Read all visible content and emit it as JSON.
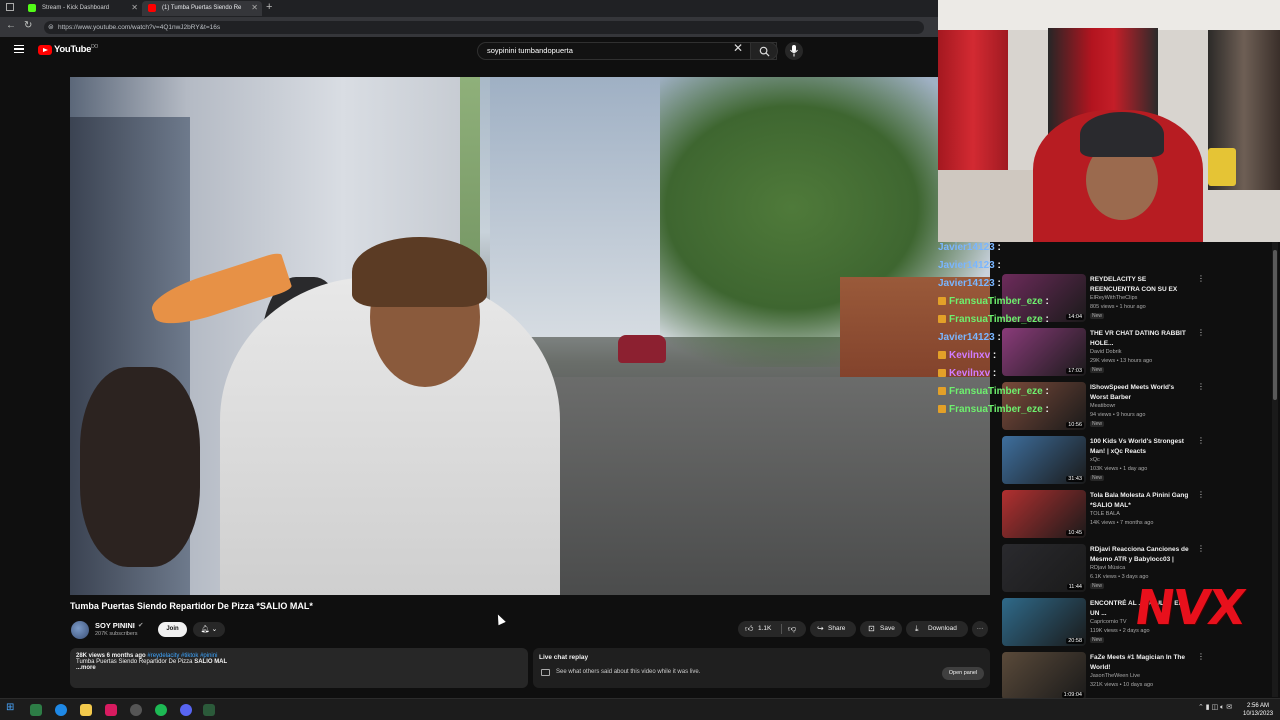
{
  "browser": {
    "tabs": [
      {
        "label": "Stream - Kick Dashboard",
        "favicon_color": "#53fc18"
      },
      {
        "label": "(1) Tumba Puertas Siendo Re",
        "favicon_color": "#ff0000"
      }
    ],
    "url": "https://www.youtube.com/watch?v=4Q1nwJ2bRY&t=16s"
  },
  "header": {
    "logo_text": "YouTube",
    "logo_country": "DO",
    "search_value": "soypinini tumbandopuerta"
  },
  "video": {
    "title": "Tumba Puertas Siendo Repartidor De Pizza *SALIO MAL*",
    "channel_name": "SOY PININI",
    "subscribers": "207K subscribers",
    "join_label": "Join",
    "like_count": "1.1K",
    "share_label": "Share",
    "save_label": "Save",
    "download_label": "Download",
    "more_label": "···"
  },
  "description": {
    "views_time": "28K views  6 months ago",
    "tags": "#reydelacity #tiktok #pinini",
    "line2_prefix": "Tumba Puertas Siendo Repartidor De Pizza",
    "line2_bold": "SALIO MAL",
    "more": "...more"
  },
  "chat_replay": {
    "heading": "Live chat replay",
    "description": "See what others said about this video while it was live.",
    "open_panel_label": "Open panel"
  },
  "chat_overlay": [
    {
      "user": "Javier14123",
      "sep": " : ",
      "color": "#7ab6ff",
      "badge": false
    },
    {
      "user": "Javier14123",
      "sep": " : ",
      "color": "#7ab6ff",
      "badge": false
    },
    {
      "user": "Javier14123",
      "sep": " : ",
      "color": "#7ab6ff",
      "badge": false
    },
    {
      "user": "FransuaTimber_eze",
      "sep": " :",
      "color": "#6ef06e",
      "badge": true
    },
    {
      "user": "FransuaTimber_eze",
      "sep": " :",
      "color": "#6ef06e",
      "badge": true
    },
    {
      "user": "Javier14123",
      "sep": " : ",
      "color": "#7ab6ff",
      "badge": false
    },
    {
      "user": "Kevilnxv",
      "sep": " :",
      "color": "#d07cff",
      "badge": true
    },
    {
      "user": "Kevilnxv",
      "sep": " :",
      "color": "#d07cff",
      "badge": true
    },
    {
      "user": "FransuaTimber_eze",
      "sep": " :",
      "color": "#6ef06e",
      "badge": true
    },
    {
      "user": "FransuaTimber_eze",
      "sep": " :",
      "color": "#6ef06e",
      "badge": true
    }
  ],
  "recommendations": [
    {
      "title": "REYDELACITY SE REENCUENTRA CON SU EX",
      "channel": "ElReyWithTheClips",
      "meta": "805 views • 1 hour ago",
      "badge": "New",
      "duration": "14:04",
      "thumb_color": "#6d2b5b"
    },
    {
      "title": "THE VR CHAT DATING RABBIT HOLE...",
      "channel": "David Dobrik",
      "meta": "29K views • 13 hours ago",
      "badge": "New",
      "duration": "17:03",
      "thumb_color": "#8a3b7a"
    },
    {
      "title": "IShowSpeed Meets World's Worst Barber",
      "channel": "Meatibowr",
      "meta": "94 views • 9 hours ago",
      "badge": "New",
      "duration": "10:56",
      "thumb_color": "#7a4a3a"
    },
    {
      "title": "100 Kids Vs World's Strongest Man! | xQc Reacts",
      "channel": "xQc",
      "meta": "103K views • 1 day ago",
      "badge": "New",
      "duration": "31:43",
      "thumb_color": "#3e6f9e"
    },
    {
      "title": "Tola Bala Molesta A Pinini Gang *SALIO MAL*",
      "channel": "TOLE BALA",
      "meta": "14K views • 7 months ago",
      "badge": "",
      "duration": "10:45",
      "thumb_color": "#b23030"
    },
    {
      "title": "RDjavi Reacciona Canciones de Mesmo ATR y Babylocc03 |",
      "channel": "RDjavi Música",
      "meta": "6.1K views • 3 days ago",
      "badge": "New",
      "duration": "11:44",
      "thumb_color": "#2a2a2e"
    },
    {
      "title": "ENCONTRÉ AL ... OCULTO EN UN ...",
      "channel": "Capricornio TV",
      "meta": "119K views • 2 days ago",
      "badge": "New",
      "duration": "20:58",
      "thumb_color": "#2f6a8a"
    },
    {
      "title": "FaZe Meets #1 Magician In The World!",
      "channel": "JasonTheWeen Live",
      "meta": "321K views • 10 days ago",
      "badge": "",
      "duration": "1:09:04",
      "thumb_color": "#5a4a3a"
    }
  ],
  "watermark": "NVX",
  "taskbar": {
    "clock_time": "2:56 AM",
    "clock_date": "10/13/2023"
  }
}
